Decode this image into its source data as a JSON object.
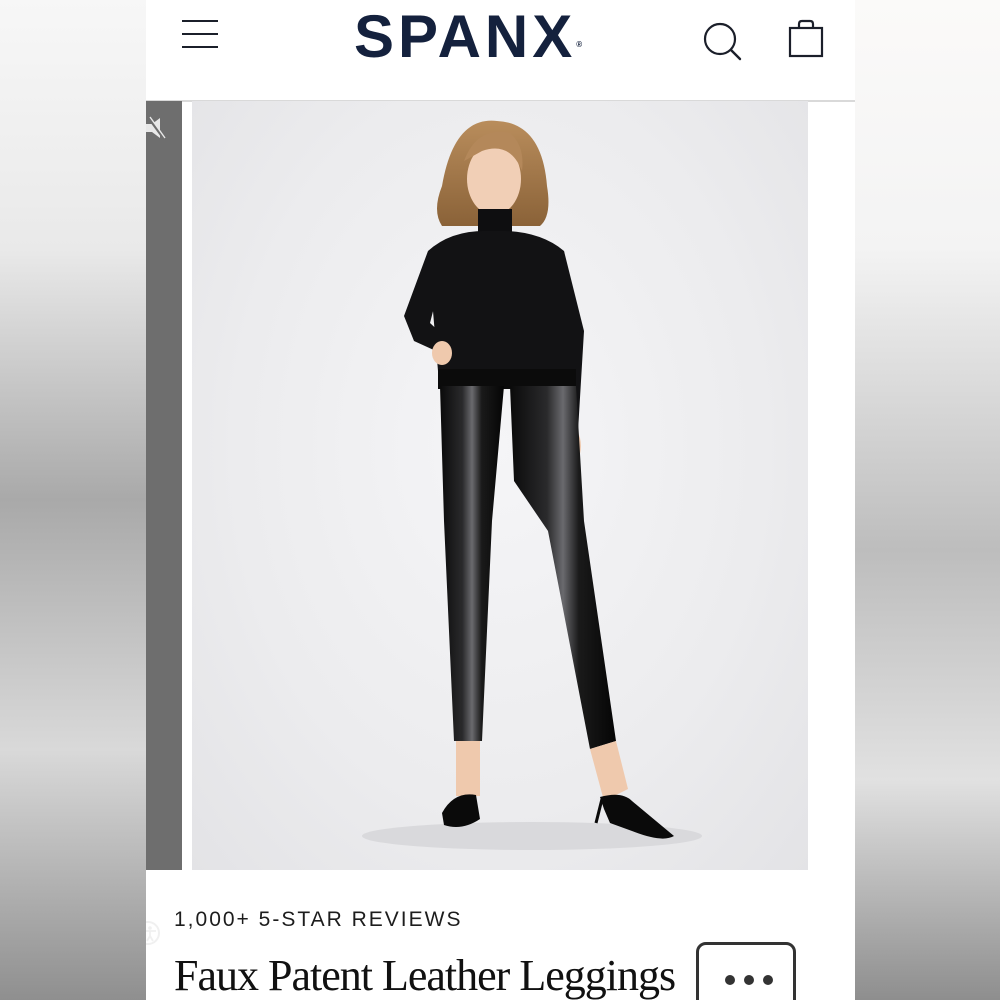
{
  "header": {
    "brand": "SPANX",
    "registered_mark": "®",
    "icons": [
      "menu-icon",
      "search-icon",
      "shopping-bag-icon"
    ]
  },
  "gallery": {
    "side_icons": [
      "mute-speaker-icon",
      "accessibility-icon"
    ],
    "image_subject": "model-in-black-turtleneck-and-patent-leggings"
  },
  "product": {
    "reviews_label": "1,000+ 5-STAR REVIEWS",
    "title": "Faux Patent Leather Leggings",
    "more_button_icon": "more-dots-icon"
  },
  "colors": {
    "brand": "#14213d",
    "side_strip": "#6e6e6e"
  }
}
